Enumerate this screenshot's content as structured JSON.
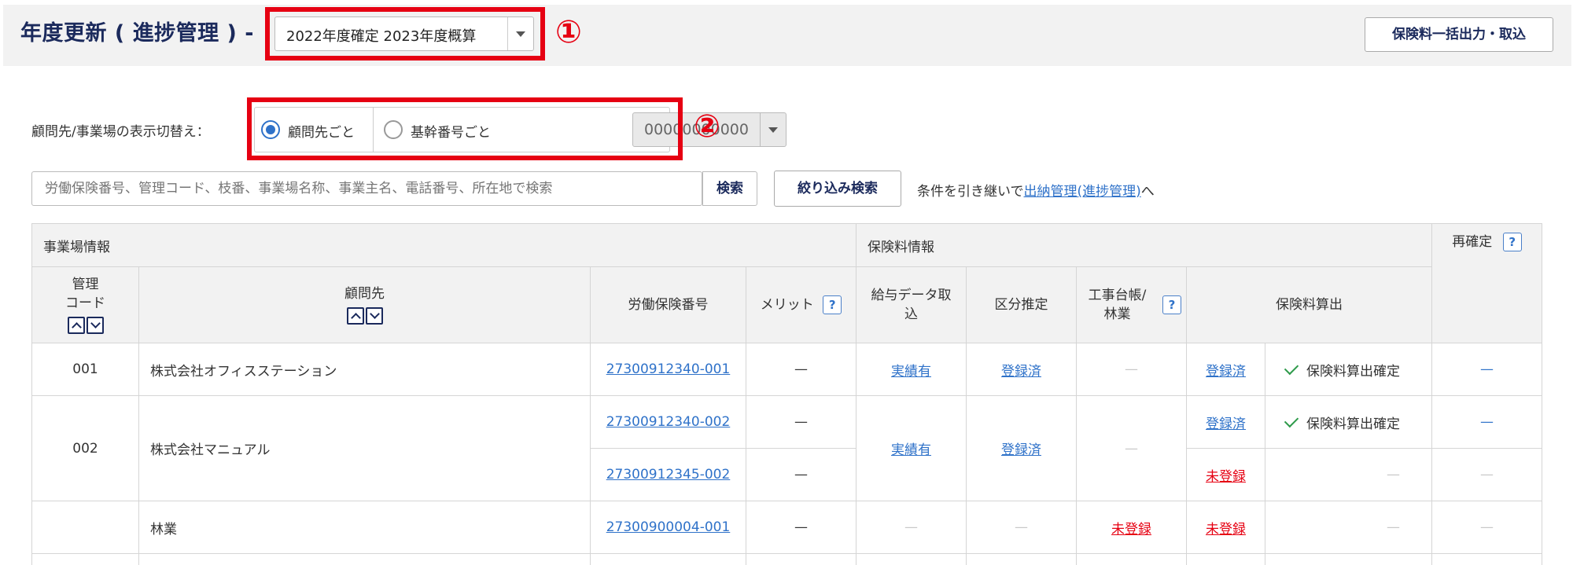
{
  "header": {
    "title": "年度更新 ( 進捗管理 ) -",
    "year_select": "2022年度確定 2023年度概算",
    "export_button": "保険料一括出力・取込"
  },
  "annotations": {
    "marker1": "①",
    "marker2": "②"
  },
  "display_toggle": {
    "label": "顧問先/事業場の表示切替え：",
    "option_client": "顧問先ごと",
    "option_base": "基幹番号ごと",
    "base_code": "00000000000",
    "selected": "顧問先ごと"
  },
  "search": {
    "placeholder": "労働保険番号、管理コード、枝番、事業場名称、事業主名、電話番号、所在地で検索",
    "button": "検索",
    "filter_button": "絞り込み検索",
    "carry_text": "条件を引き継いで",
    "carry_link": "出納管理(進捗管理)",
    "carry_suffix": "へ"
  },
  "table": {
    "group_site": "事業場情報",
    "group_premium": "保険料情報",
    "col_code_1": "管理",
    "col_code_2": "コード",
    "col_client": "顧問先",
    "col_number": "労働保険番号",
    "col_merit": "メリット",
    "col_payroll_1": "給与データ取",
    "col_payroll_2": "込",
    "col_class": "区分推定",
    "col_ledger_1": "工事台帳/",
    "col_ledger_2": "林業",
    "col_calc": "保険料算出",
    "col_reconfirm": "再確定",
    "help": "?",
    "rows": [
      {
        "code": "001",
        "client": "株式会社オフィスステーション",
        "number": "27300912340-001",
        "merit": "—",
        "payroll": "実績有",
        "class": "登録済",
        "ledger": "—",
        "calc": "登録済",
        "status": "保険料算出確定",
        "reconfirm": "—"
      },
      {
        "code": "002",
        "client": "株式会社マニュアル",
        "number": "27300912340-002",
        "merit": "—",
        "payroll": "実績有",
        "class": "登録済",
        "ledger": "—",
        "calc": "登録済",
        "status": "保険料算出確定",
        "reconfirm": "—"
      },
      {
        "number": "27300912345-002",
        "merit": "—",
        "calc": "未登録",
        "status": "—",
        "reconfirm": "—"
      },
      {
        "code": "",
        "client": "林業",
        "number": "27300900004-001",
        "merit": "—",
        "payroll": "—",
        "class": "—",
        "ledger": "未登録",
        "calc": "未登録",
        "status": "—",
        "reconfirm": "—"
      }
    ]
  },
  "colors": {
    "accent": "#2f72c9",
    "title": "#1b2a5c",
    "highlight": "#e60012",
    "header_bg": "#f2f2f2"
  }
}
